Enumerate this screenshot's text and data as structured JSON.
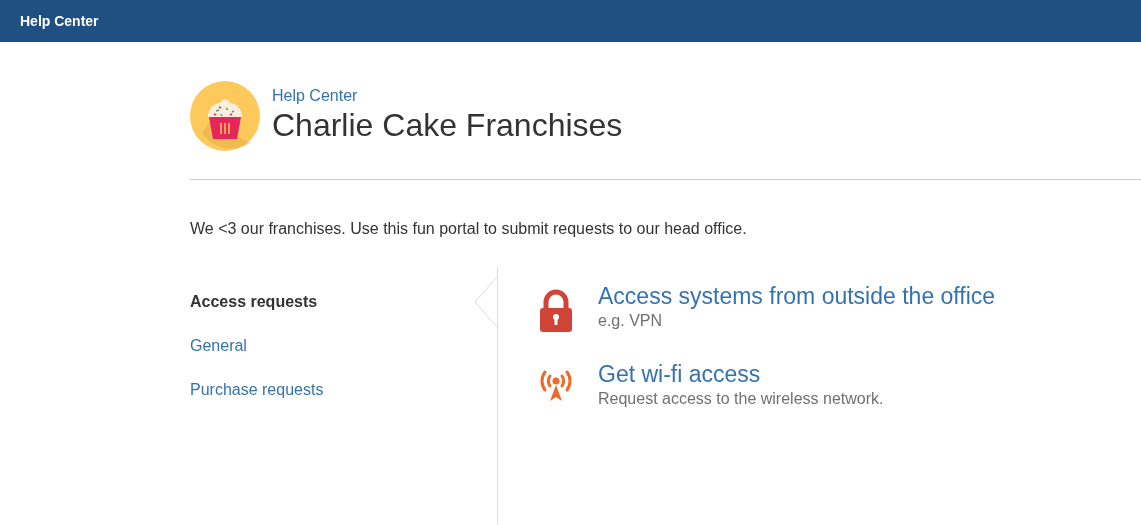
{
  "top_bar": {
    "title": "Help Center"
  },
  "header": {
    "breadcrumb": "Help Center",
    "title": "Charlie Cake Franchises"
  },
  "description": "We <3 our franchises. Use this fun portal to submit requests to our head office.",
  "categories": [
    {
      "label": "Access requests",
      "selected": true
    },
    {
      "label": "General",
      "selected": false
    },
    {
      "label": "Purchase requests",
      "selected": false
    }
  ],
  "request_types": [
    {
      "kind": "lock",
      "title": "Access systems from outside the office",
      "subtitle": "e.g. VPN"
    },
    {
      "kind": "wifi",
      "title": "Get wi-fi access",
      "subtitle": "Request access to the wireless network."
    }
  ]
}
